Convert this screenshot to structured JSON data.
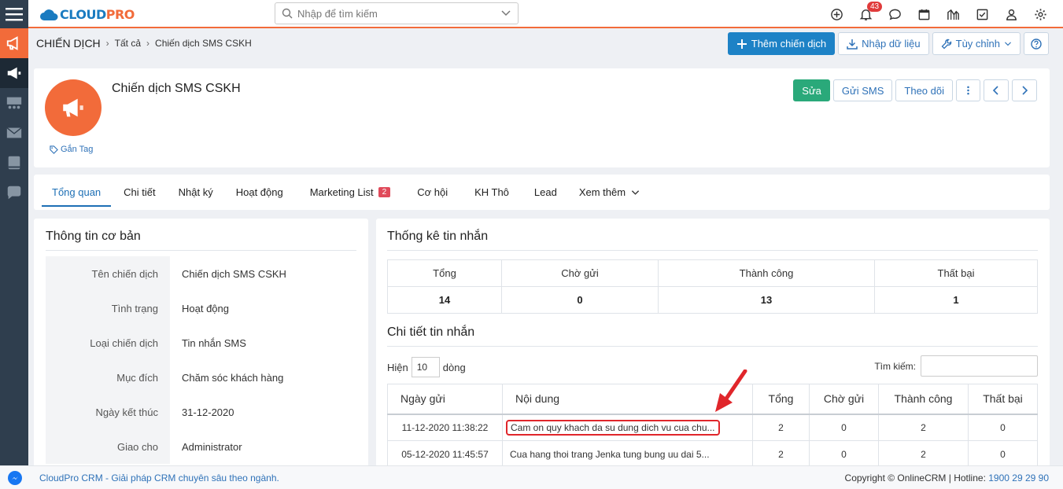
{
  "app": {
    "logo_main": "CLOUD",
    "logo_accent": "PRO",
    "search_placeholder": "Nhập để tìm kiếm",
    "notification_count": "43",
    "colors": {
      "accent": "#f26b3a",
      "primary": "#1d82c6",
      "success": "#2aa97a",
      "sidebar": "#2f3e4e"
    }
  },
  "sidebar": {
    "items": [
      {
        "icon": "megaphone-icon",
        "active": "orange"
      },
      {
        "icon": "bullhorn-icon",
        "active": "dark"
      },
      {
        "icon": "group-icon"
      },
      {
        "icon": "envelope-icon"
      },
      {
        "icon": "book-icon"
      },
      {
        "icon": "chat-icon"
      }
    ]
  },
  "topbar_icons": [
    "plus-circle-icon",
    "bell-icon",
    "chat-bubble-icon",
    "calendar-icon",
    "chart-icon",
    "check-square-icon",
    "user-icon",
    "gear-icon"
  ],
  "breadcrumb": {
    "root": "CHIẾN DỊCH",
    "level1": "Tất cả",
    "level2": "Chiến dịch SMS CSKH"
  },
  "toolbar": {
    "add_label": "Thêm chiến dịch",
    "import_label": "Nhập dữ liệu",
    "customize_label": "Tùy chỉnh"
  },
  "record": {
    "title": "Chiến dịch SMS CSKH",
    "tag_label": "Gắn Tag",
    "edit_label": "Sửa",
    "send_sms_label": "Gửi SMS",
    "follow_label": "Theo dõi"
  },
  "tabs": [
    {
      "label": "Tổng quan"
    },
    {
      "label": "Chi tiết"
    },
    {
      "label": "Nhật ký"
    },
    {
      "label": "Hoạt động"
    },
    {
      "label": "Marketing List",
      "count": "2"
    },
    {
      "label": "Cơ hội"
    },
    {
      "label": "KH Thô"
    },
    {
      "label": "Lead"
    },
    {
      "label": "Xem thêm"
    }
  ],
  "basic_info": {
    "title": "Thông tin cơ bản",
    "rows": [
      {
        "label": "Tên chiến dịch",
        "value": "Chiến dịch SMS CSKH"
      },
      {
        "label": "Tình trạng",
        "value": "Hoạt động"
      },
      {
        "label": "Loại chiến dịch",
        "value": "Tin nhắn SMS"
      },
      {
        "label": "Mục đích",
        "value": "Chăm sóc khách hàng"
      },
      {
        "label": "Ngày kết thúc",
        "value": "31-12-2020"
      },
      {
        "label": "Giao cho",
        "value": "Administrator"
      }
    ]
  },
  "stats": {
    "title": "Thống kê tin nhắn",
    "headers": [
      "Tổng",
      "Chờ gửi",
      "Thành công",
      "Thất bại"
    ],
    "values": [
      "14",
      "0",
      "13",
      "1"
    ]
  },
  "messages": {
    "title": "Chi tiết tin nhắn",
    "show_label": "Hiện",
    "page_size": "10",
    "rows_label": "dòng",
    "search_label": "Tìm kiếm:",
    "headers": [
      "Ngày gửi",
      "Nội dung",
      "Tổng",
      "Chờ gửi",
      "Thành công",
      "Thất bại"
    ],
    "rows": [
      {
        "date": "11-12-2020 11:38:22",
        "content": "Cam on quy khach da su dung dich vu cua chu...",
        "total": "2",
        "pending": "0",
        "success": "2",
        "failed": "0"
      },
      {
        "date": "05-12-2020 11:45:57",
        "content": "Cua hang thoi trang Jenka tung bung uu dai 5...",
        "total": "2",
        "pending": "0",
        "success": "2",
        "failed": "0"
      }
    ]
  },
  "footer": {
    "left": "CloudPro CRM - Giải pháp CRM chuyên sâu theo ngành.",
    "right": "Copyright © OnlineCRM | Hotline: ",
    "phone": "1900 29 29 90"
  }
}
